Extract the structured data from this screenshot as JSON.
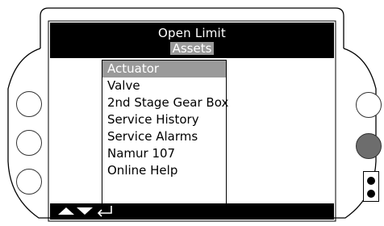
{
  "header": {
    "title": "Open Limit",
    "subtitle": "Assets"
  },
  "menu": {
    "items": [
      {
        "label": "Actuator",
        "selected": true
      },
      {
        "label": "Valve",
        "selected": false
      },
      {
        "label": "2nd Stage Gear Box",
        "selected": false
      },
      {
        "label": "Service History",
        "selected": false
      },
      {
        "label": "Service Alarms",
        "selected": false
      },
      {
        "label": "Namur 107",
        "selected": false
      },
      {
        "label": "Online Help",
        "selected": false
      }
    ]
  },
  "footer": {
    "icons": [
      "up-arrow-icon",
      "down-arrow-icon",
      "enter-icon"
    ]
  },
  "colors": {
    "highlight": "#9a9a9a",
    "header_bg": "#000000",
    "right_middle_button": "#6d6d6d"
  }
}
